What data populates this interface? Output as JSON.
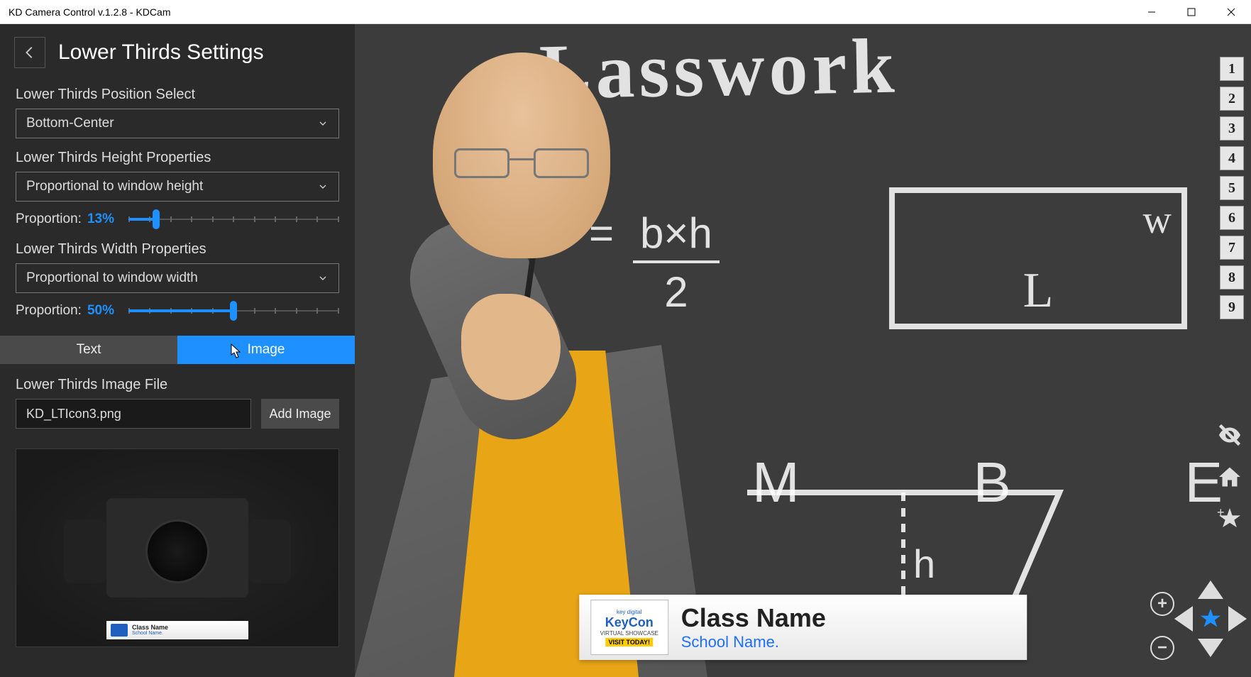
{
  "window": {
    "title": "KD Camera Control v.1.2.8 - KDCam"
  },
  "sidebar": {
    "title": "Lower Thirds Settings",
    "position_label": "Lower Thirds Position Select",
    "position_value": "Bottom-Center",
    "height_label": "Lower Thirds Height Properties",
    "height_value": "Proportional to window height",
    "height_prop_label": "Proportion:",
    "height_prop_value": "13%",
    "height_prop_percent": 13,
    "width_label": "Lower Thirds Width Properties",
    "width_value": "Proportional to window width",
    "width_prop_label": "Proportion:",
    "width_prop_value": "50%",
    "width_prop_percent": 50,
    "tabs": {
      "text": "Text",
      "image": "Image",
      "active": "image"
    },
    "image_file_label": "Lower Thirds Image File",
    "image_file_value": "KD_LTIcon3.png",
    "add_image_label": "Add Image",
    "preview_lt": {
      "title": "Class Name",
      "subtitle": "School Name."
    }
  },
  "lower_third": {
    "icon_brand_top": "key digital",
    "icon_brand": "KeyCon",
    "icon_sub": "VIRTUAL SHOWCASE",
    "icon_visit": "VISIT TODAY!",
    "title": "Class Name",
    "subtitle": "School Name."
  },
  "chalkboard": {
    "title_text": "Lasswork",
    "formula_prefix": "=",
    "formula_num": "b×h",
    "formula_den": "2",
    "rect_l": "L",
    "rect_w": "w",
    "letter_m": "M",
    "letter_b": "B",
    "letter_e": "E",
    "trap_h": "h"
  },
  "presets": [
    "1",
    "2",
    "3",
    "4",
    "5",
    "6",
    "7",
    "8",
    "9"
  ],
  "colors": {
    "accent": "#1e90ff"
  }
}
